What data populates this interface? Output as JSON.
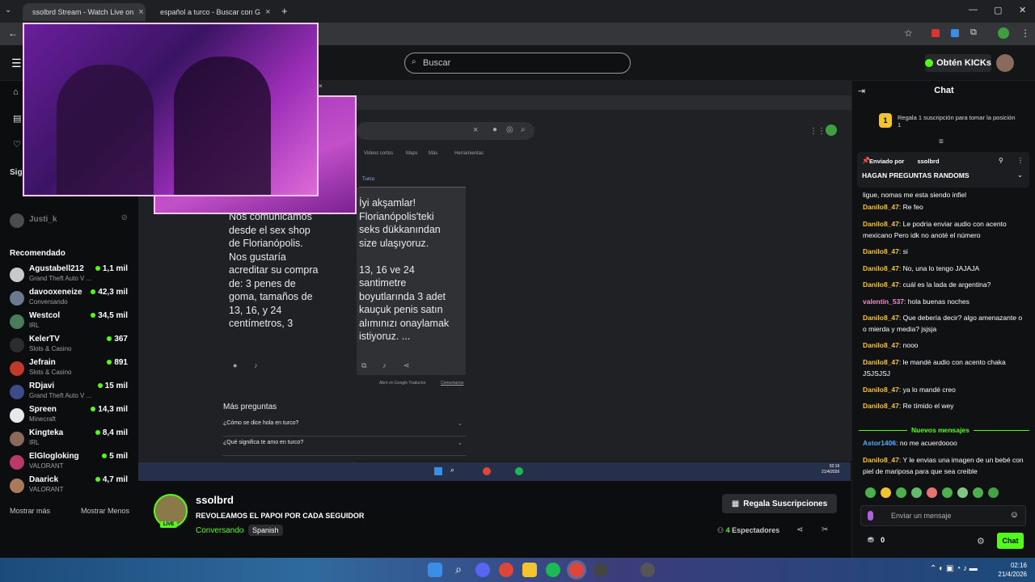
{
  "browser": {
    "tabs": [
      {
        "title": "ssolbrd Stream - Watch Live on"
      },
      {
        "title": "español a turco - Buscar con G"
      }
    ]
  },
  "kick_header": {
    "search_placeholder": "Buscar",
    "kicks_button": "Obtén KICKs"
  },
  "sidebar": {
    "section_following": "Sigui",
    "following": [
      {
        "name": "Justi_k"
      }
    ],
    "section_recommended": "Recomendado",
    "channels": [
      {
        "name": "Agustabell212",
        "category": "Grand Theft Auto V ...",
        "viewers": "1,1 mil",
        "color": "#c9c9c9"
      },
      {
        "name": "davooxeneize",
        "category": "Conversando",
        "viewers": "42,3 mil",
        "color": "#6b7a8f"
      },
      {
        "name": "Westcol",
        "category": "IRL",
        "viewers": "34,5 mil",
        "color": "#4a7c59"
      },
      {
        "name": "KelerTV",
        "category": "Slots & Casino",
        "viewers": "367",
        "color": "#2d2d2d"
      },
      {
        "name": "Jefrain",
        "category": "Slots & Casino",
        "viewers": "891",
        "color": "#c0392b"
      },
      {
        "name": "RDjavi",
        "category": "Grand Theft Auto V ...",
        "viewers": "15 mil",
        "color": "#3d4b8a"
      },
      {
        "name": "Spreen",
        "category": "Minecraft",
        "viewers": "14,3 mil",
        "color": "#e8e8e8"
      },
      {
        "name": "Kingteka",
        "category": "IRL",
        "viewers": "8,4 mil",
        "color": "#8a6a5a"
      },
      {
        "name": "ElGlogloking",
        "category": "VALORANT",
        "viewers": "5 mil",
        "color": "#b83a6a"
      },
      {
        "name": "Daarick",
        "category": "VALORANT",
        "viewers": "4,7 mil",
        "color": "#a87a5a"
      }
    ],
    "show_more": "Mostrar más",
    "show_less": "Mostrar Menos"
  },
  "google_window": {
    "filters": [
      "Videos cortos",
      "Maps",
      "Más",
      "Herramientas"
    ],
    "target_language": "Turco",
    "source_text": "Nos comunicamos desde el sex shop de Florianópolis. Nos gustaría acreditar su compra de: 3 penes de goma, tamaños de 13, 16, y 24 centímetros, 3",
    "source_lines": [
      "Nos comunicamos",
      "desde el sex shop",
      "de Florianópolis.",
      "Nos gustaría",
      "acreditar su compra",
      "de: 3 penes de",
      "goma, tamaños de",
      "13, 16, y 24",
      "centímetros, 3"
    ],
    "translated_lines": [
      "İyi akşamlar!",
      "Florianópolis'teki",
      "seks dükkanından",
      "size ulaşıyoruz.",
      "",
      "13, 16 ve 24",
      "santimetre",
      "boyutlarında 3 adet",
      "kauçuk penis satın",
      "alımınızı onaylamak",
      "istiyoruz. ..."
    ],
    "footer_open": "Abrir en Google Traductor",
    "footer_comments": "Comentarios",
    "more_questions": "Más preguntas",
    "questions": [
      "¿Cómo se dice hola en turco?",
      "¿Qué significa te amo en turco?"
    ]
  },
  "stream": {
    "streamer": "ssolbrd",
    "title": "REVOLEAMOS EL PAPOI POR CADA SEGUIDOR",
    "category": "Conversando",
    "language_tag": "Spanish",
    "live_badge": "LIVE",
    "gift_button": "Regala Suscripciones",
    "viewers": "4",
    "viewers_label": "Espectadores"
  },
  "chat": {
    "title": "Chat",
    "gift_banner": "Regala 1 suscripción para tomar la posición 1",
    "gift_rank": "1",
    "pinned_by_label": "Enviado por",
    "pinned_by": "ssolbrd",
    "pinned_message": "HAGAN PREGUNTAS RANDOMS",
    "partial_top": "ligue, nomas me esta siendo infiel",
    "messages": [
      {
        "user": "Danilo8_47",
        "text": "Re feo",
        "color": "#f4c430"
      },
      {
        "user": "Danilo8_47",
        "text": "Le podria enviar audio con acento mexicano Pero idk no anoté el número",
        "color": "#f4c430"
      },
      {
        "user": "Danilo8_47",
        "text": "si",
        "color": "#f4c430"
      },
      {
        "user": "Danilo8_47",
        "text": "No, una lo tengo JAJAJA",
        "color": "#f4c430"
      },
      {
        "user": "Danilo8_47",
        "text": "cuál es la lada de argentina?",
        "color": "#f4c430"
      },
      {
        "user": "valentin_537",
        "text": "hola buenas noches",
        "color": "#f28cc4"
      },
      {
        "user": "Danilo8_47",
        "text": "Que debería decir? algo amenazante o o mierda y media? jsjsja",
        "color": "#f4c430"
      },
      {
        "user": "Danilo8_47",
        "text": "nooo",
        "color": "#f4c430"
      },
      {
        "user": "Danilo8_47",
        "text": "le mandé audio con acento chaka JSJSJSJ",
        "color": "#f4c430"
      },
      {
        "user": "Danilo8_47",
        "text": "ya lo mandé creo",
        "color": "#f4c430"
      },
      {
        "user": "Danilo8_47",
        "text": "Re tímido el wey",
        "color": "#f4c430"
      }
    ],
    "new_messages_label": "Nuevos mensajes",
    "new_messages": [
      {
        "user": "Astor1406",
        "text": "no me acuerdoooo",
        "color": "#5aa9ff"
      },
      {
        "user": "Danilo8_47",
        "text": "Y le envias una imagen de un bebé con piel de mariposa para que sea creible",
        "color": "#f4c430"
      }
    ],
    "input_placeholder": "Enviar un mensaje",
    "points": "0",
    "send_button": "Chat"
  },
  "taskbar": {
    "inner_time": "02:16",
    "inner_date": "21/4/2026",
    "time": "02:16",
    "date": "21/4/2026"
  }
}
